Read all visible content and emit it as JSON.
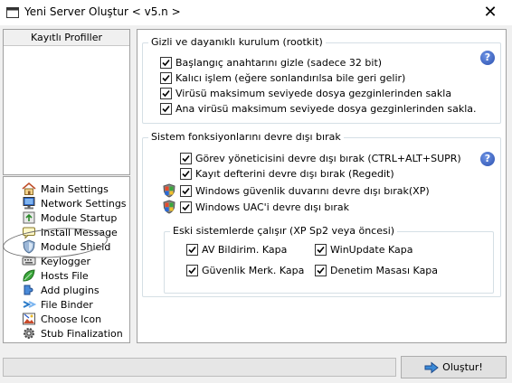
{
  "window": {
    "title": "Yeni Server Oluştur < v5.n >",
    "close_glyph": "✕"
  },
  "profiles": {
    "header": "Kayıtlı Profiller"
  },
  "nav": {
    "items": [
      {
        "label": "Main Settings",
        "icon": "home-icon"
      },
      {
        "label": "Network Settings",
        "icon": "network-icon"
      },
      {
        "label": "Module Startup",
        "icon": "startup-icon"
      },
      {
        "label": "Install Message",
        "icon": "message-icon"
      },
      {
        "label": "Module Shield",
        "icon": "shield-icon"
      },
      {
        "label": "Keylogger",
        "icon": "keyboard-icon"
      },
      {
        "label": "Hosts File",
        "icon": "leaf-icon"
      },
      {
        "label": "Add plugins",
        "icon": "plugin-icon"
      },
      {
        "label": "File Binder",
        "icon": "binder-icon"
      },
      {
        "label": "Choose Icon",
        "icon": "image-icon"
      },
      {
        "label": "Stub Finalization",
        "icon": "gear-icon"
      }
    ]
  },
  "group_hidden": {
    "title": "Gizli ve dayanıklı kurulum  (rootkit)",
    "help": "?",
    "options": [
      {
        "label": "Başlangıç anahtarını gizle (sadece 32 bit)",
        "checked": true
      },
      {
        "label": "Kalıcı işlem (eğere sonlandırılsa bile geri gelir)",
        "checked": true
      },
      {
        "label": "Virüsü maksimum seviyede dosya gezginlerinden sakla",
        "checked": true
      },
      {
        "label": "Ana virüsü maksimum seviyede dosya gezginlerinden sakla.",
        "checked": true
      }
    ]
  },
  "group_disable": {
    "title": "Sistem fonksiyonlarını devre dışı bırak",
    "help": "?",
    "options": [
      {
        "label": "Görev yöneticisini devre dışı bırak (CTRL+ALT+SUPR)",
        "checked": true
      },
      {
        "label": "Kayıt defterini devre dışı bırak (Regedit)",
        "checked": true
      },
      {
        "label": "Windows güvenlik duvarını devre dışı bırak(XP)",
        "checked": true
      },
      {
        "label": "Windows UAC'i devre dışı bırak",
        "checked": true
      }
    ]
  },
  "group_old": {
    "title": "Eski sistemlerde çalışır (XP Sp2 veya öncesi)",
    "options": [
      {
        "label": "AV Bildirim. Kapa",
        "checked": true
      },
      {
        "label": "WinUpdate Kapa",
        "checked": true
      },
      {
        "label": "Güvenlik Merk. Kapa",
        "checked": true
      },
      {
        "label": "Denetim Masası Kapa",
        "checked": true
      }
    ]
  },
  "progress": {
    "value": 0.0
  },
  "create_button": {
    "label": "Oluştur!"
  },
  "colors": {
    "progress_green": "#06b025",
    "help_blue": "#2a4fae"
  }
}
